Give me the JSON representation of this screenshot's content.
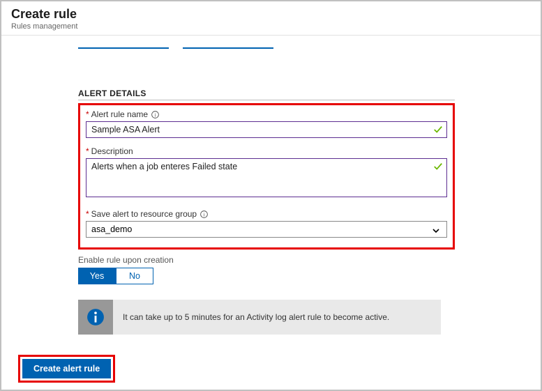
{
  "header": {
    "title": "Create rule",
    "subtitle": "Rules management"
  },
  "section": {
    "heading": "ALERT DETAILS",
    "ruleName": {
      "label": "Alert rule name",
      "value": "Sample ASA Alert"
    },
    "description": {
      "label": "Description",
      "value": "Alerts when a job enteres Failed state"
    },
    "resourceGroup": {
      "label": "Save alert to resource group",
      "value": "asa_demo"
    }
  },
  "enable": {
    "label": "Enable rule upon creation",
    "yes": "Yes",
    "no": "No"
  },
  "message": "It can take up to 5 minutes for an Activity log alert rule to become active.",
  "footer": {
    "create": "Create alert rule"
  }
}
